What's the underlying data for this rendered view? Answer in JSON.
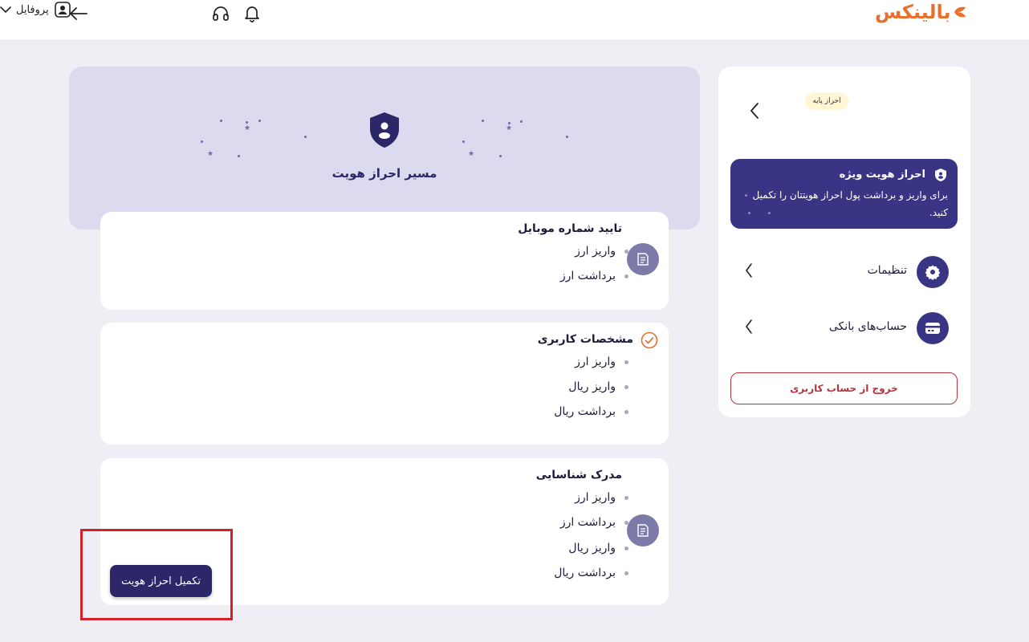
{
  "header": {
    "profile_label": "پروفایل",
    "logo_text": "بالینکس",
    "icons": [
      "back-arrow-icon",
      "chevron-down-icon",
      "user-icon",
      "headset-icon",
      "bell-icon"
    ]
  },
  "banner": {
    "title": "مسیر احراز هویت",
    "icon": "shield-user-icon"
  },
  "cards": [
    {
      "title": "تایید شماره موبایل",
      "icon": "document-icon",
      "items": [
        "واریز ارز",
        "برداشت ارز"
      ]
    },
    {
      "title": "مشخصات کاربری",
      "icon": "check-circle-icon",
      "items": [
        "واریز ارز",
        "واریز ریال",
        "برداشت ریال"
      ]
    },
    {
      "title": "مدرک شناسایی",
      "icon": "document-icon",
      "items": [
        "واریز ارز",
        "برداشت ارز",
        "واریز ریال",
        "برداشت ریال"
      ]
    }
  ],
  "complete_button_label": "تکمیل احراز هویت",
  "sidebar": {
    "level_badge": "احراز پایه",
    "promo": {
      "title": "احراز هویت ویژه",
      "description": "برای واریز و برداشت پول احراز هویتتان را تکمیل کنید."
    },
    "menu": [
      {
        "label": "تنظیمات",
        "icon": "gear-icon"
      },
      {
        "label": "حساب‌های بانکی",
        "icon": "bank-card-icon"
      }
    ],
    "logout_label": "خروج از حساب کاربری"
  },
  "colors": {
    "primary": "#2b2768",
    "brand": "#e8702e",
    "banner_bg": "#dcdaee",
    "logout": "#b8323a",
    "highlight": "#d3202a"
  }
}
